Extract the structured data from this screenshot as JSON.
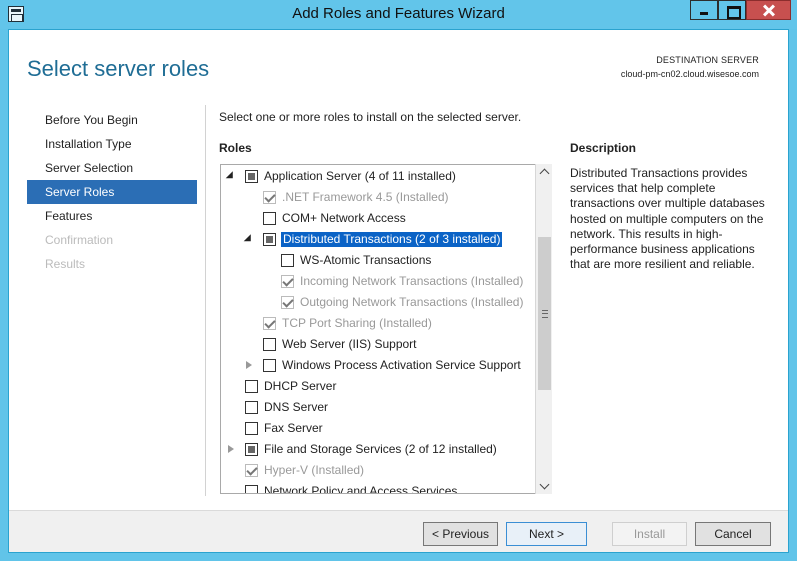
{
  "window": {
    "title": "Add Roles and Features Wizard"
  },
  "header": {
    "title": "Select server roles",
    "destination_label": "DESTINATION SERVER",
    "destination_server": "cloud-pm-cn02.cloud.wisesoe.com"
  },
  "nav": {
    "items": [
      {
        "label": "Before You Begin"
      },
      {
        "label": "Installation Type"
      },
      {
        "label": "Server Selection"
      },
      {
        "label": "Server Roles"
      },
      {
        "label": "Features"
      },
      {
        "label": "Confirmation"
      },
      {
        "label": "Results"
      }
    ]
  },
  "content": {
    "intro": "Select one or more roles to install on the selected server.",
    "roles_heading": "Roles",
    "description_heading": "Description",
    "description_text": "Distributed Transactions provides services that help complete transactions over multiple databases hosted on multiple computers on the network. This results in high-performance business applications that are more resilient and reliable."
  },
  "roles": {
    "rows": [
      {
        "label": "Application Server (4 of 11 installed)"
      },
      {
        "label": ".NET Framework 4.5 (Installed)"
      },
      {
        "label": "COM+ Network Access"
      },
      {
        "label": "Distributed Transactions (2 of 3 installed)"
      },
      {
        "label": "WS-Atomic Transactions"
      },
      {
        "label": "Incoming Network Transactions (Installed)"
      },
      {
        "label": "Outgoing Network Transactions (Installed)"
      },
      {
        "label": "TCP Port Sharing (Installed)"
      },
      {
        "label": "Web Server (IIS) Support"
      },
      {
        "label": "Windows Process Activation Service Support"
      },
      {
        "label": "DHCP Server"
      },
      {
        "label": "DNS Server"
      },
      {
        "label": "Fax Server"
      },
      {
        "label": "File and Storage Services (2 of 12 installed)"
      },
      {
        "label": "Hyper-V (Installed)"
      },
      {
        "label": "Network Policy and Access Services"
      }
    ]
  },
  "buttons": {
    "previous": "< Previous",
    "next": "Next >",
    "install": "Install",
    "cancel": "Cancel"
  }
}
